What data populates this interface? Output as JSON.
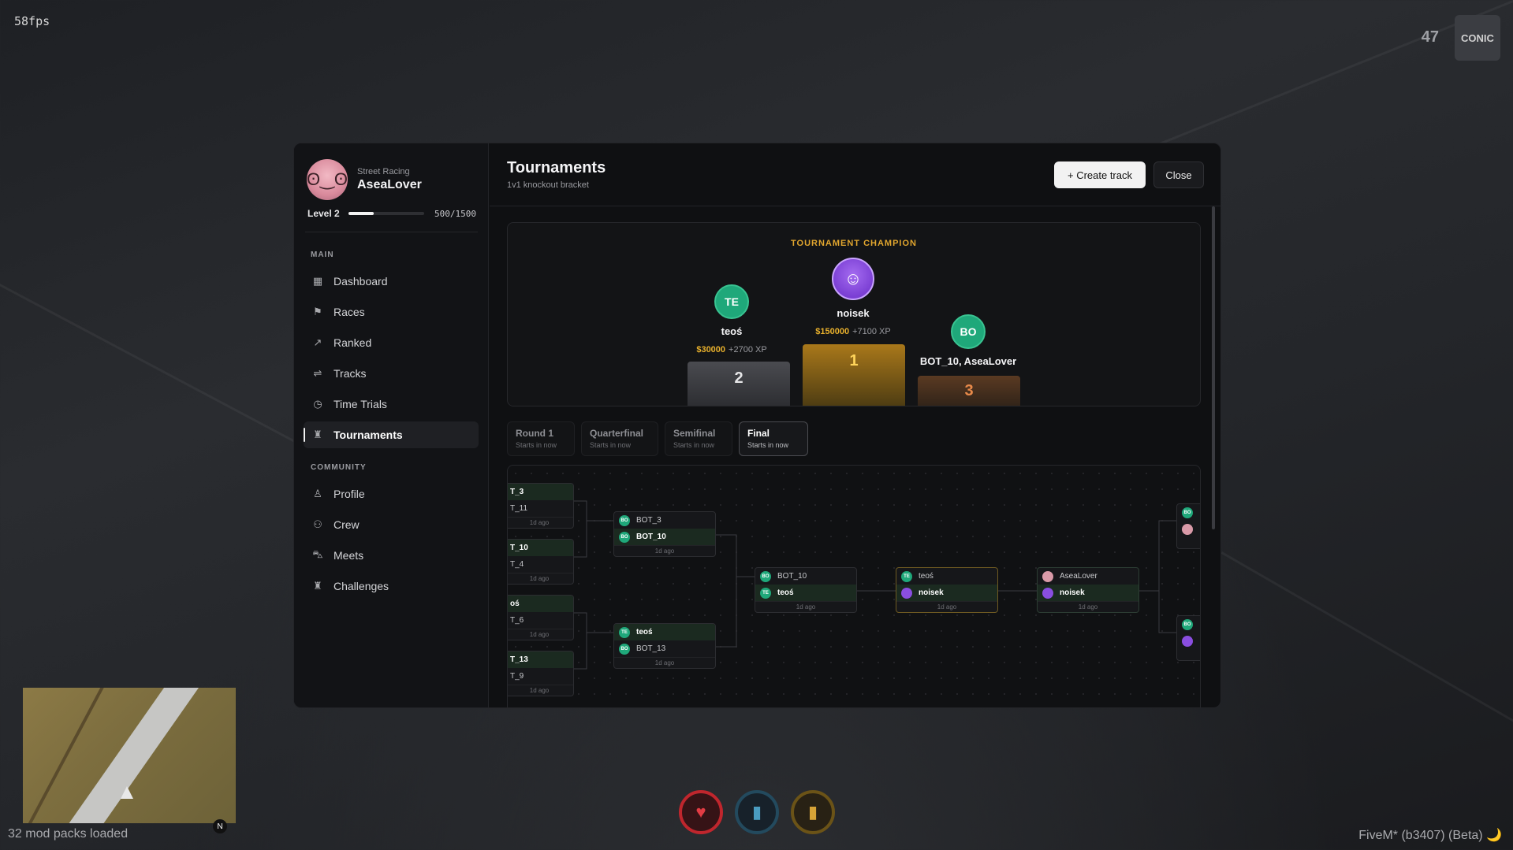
{
  "hud": {
    "fps": "58fps",
    "top_number": "47",
    "logo": "CONIC",
    "mods": "32 mod packs loaded",
    "version": "FiveM* (b3407) (Beta) 🌙",
    "compass": "N"
  },
  "profile": {
    "subtitle": "Street Racing",
    "name": "AseaLover",
    "level": "Level 2",
    "xp": "500/1500",
    "xp_progress": 0.333
  },
  "nav": {
    "main_label": "MAIN",
    "community_label": "COMMUNITY",
    "main": [
      {
        "label": "Dashboard",
        "icon": "grid-icon"
      },
      {
        "label": "Races",
        "icon": "flag-icon"
      },
      {
        "label": "Ranked",
        "icon": "trend-icon"
      },
      {
        "label": "Tracks",
        "icon": "route-icon"
      },
      {
        "label": "Time Trials",
        "icon": "clock-icon"
      },
      {
        "label": "Tournaments",
        "icon": "trophy-icon",
        "active": true
      }
    ],
    "community": [
      {
        "label": "Profile",
        "icon": "user-icon"
      },
      {
        "label": "Crew",
        "icon": "users-icon"
      },
      {
        "label": "Meets",
        "icon": "car-icon"
      },
      {
        "label": "Challenges",
        "icon": "trophy-icon"
      }
    ]
  },
  "header": {
    "title": "Tournaments",
    "subtitle": "1v1 knockout bracket",
    "create_label": "+ Create track",
    "close_label": "Close"
  },
  "champion": {
    "title": "TOURNAMENT CHAMPION",
    "first": {
      "initials": "",
      "name": "noisek",
      "money": "$150000",
      "xp": "+7100 XP",
      "place": "1"
    },
    "second": {
      "initials": "TE",
      "name": "teoś",
      "money": "$30000",
      "xp": "+2700 XP",
      "place": "2"
    },
    "third": {
      "initials": "BO",
      "name": "BOT_10, AseaLover",
      "place": "3"
    }
  },
  "rounds": [
    {
      "name": "Round 1",
      "time": "Starts in now"
    },
    {
      "name": "Quarterfinal",
      "time": "Starts in now"
    },
    {
      "name": "Semifinal",
      "time": "Starts in now"
    },
    {
      "name": "Final",
      "time": "Starts in now",
      "active": true
    }
  ],
  "bracket": {
    "r1": [
      {
        "a": "T_3",
        "b": "T_11",
        "time": "1d ago"
      },
      {
        "a": "T_10",
        "b": "T_4",
        "time": "1d ago"
      },
      {
        "a": "oś",
        "b": "T_6",
        "time": "1d ago"
      },
      {
        "a": "T_13",
        "b": "T_9",
        "time": "1d ago"
      }
    ],
    "qf": [
      {
        "a": "BOT_3",
        "a_ava": "BO",
        "b": "BOT_10",
        "b_ava": "BO",
        "win": "b",
        "time": "1d ago"
      },
      {
        "a": "teoś",
        "a_ava": "TE",
        "b": "BOT_13",
        "b_ava": "BO",
        "win": "a",
        "time": "1d ago"
      }
    ],
    "sf": {
      "a": "BOT_10",
      "a_ava": "BO",
      "b": "teoś",
      "b_ava": "TE",
      "win": "b",
      "time": "1d ago"
    },
    "final": {
      "a": "teoś",
      "a_ava": "TE",
      "b": "noisek",
      "b_ava": "",
      "win": "b",
      "time": "1d ago"
    },
    "third": {
      "a": "AseaLover",
      "a_ava": "",
      "b": "noisek",
      "b_ava": "",
      "win": "b",
      "time": "1d ago"
    },
    "right_top": {
      "a_ava": "BO",
      "b_ava": ""
    },
    "right_bottom": {
      "a_ava": "BO",
      "b_ava": ""
    }
  },
  "colors": {
    "accent_gold": "#e0a52e",
    "bot_green": "#1fa87a",
    "panel_bg": "#0f1012"
  }
}
